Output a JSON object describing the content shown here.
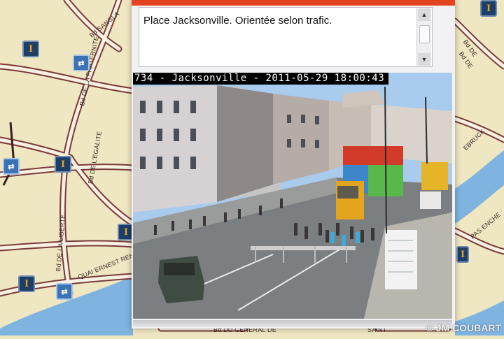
{
  "map": {
    "street_labels": [
      "Bd DE LA FRATERNITE",
      "Bd DE L'EGALITE",
      "Bd DE LA LIBERTE",
      "QUAI ERNEST RENAUD",
      "Bd DU GENERAL DE",
      "SAINT",
      "Bd DE",
      "Bd DE",
      "EBRUCK",
      "PAS ENCHE",
      "Bd SANGLA"
    ],
    "icons": {
      "camera": "webcam-camera-icon",
      "info": "traffic-info-icon"
    }
  },
  "popup": {
    "accent_color": "#e4431f",
    "description": "Place Jacksonville. Orientée selon trafic.",
    "scroll_up": "▲",
    "scroll_down": "▼",
    "camera": {
      "overlay": "734 - Jacksonville - 2011-05-29 18:00:43"
    }
  },
  "watermark": "© JM COUBART"
}
